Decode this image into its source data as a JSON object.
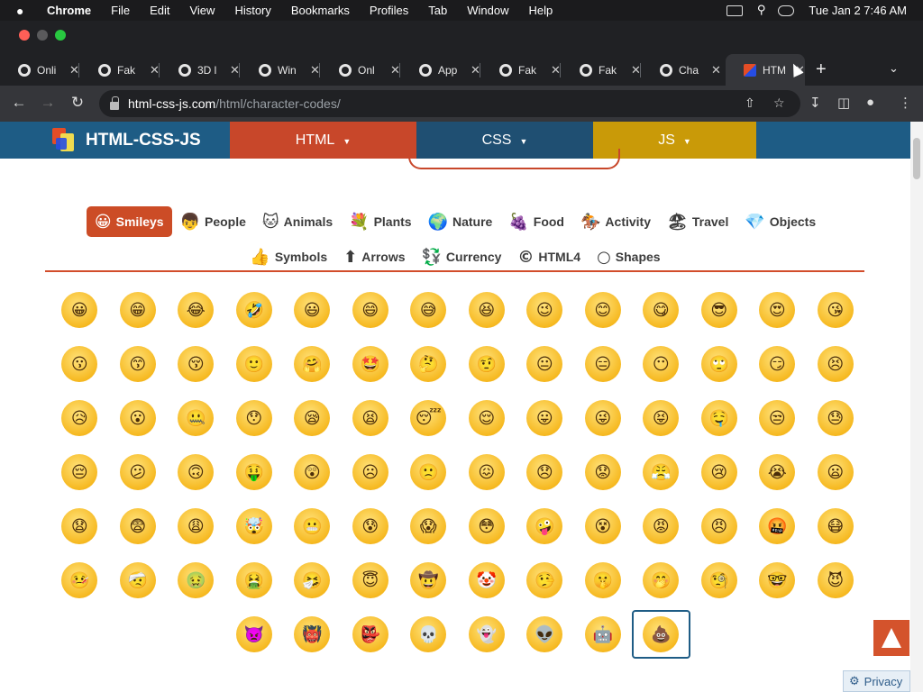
{
  "menubar": {
    "app": "Chrome",
    "items": [
      "File",
      "Edit",
      "View",
      "History",
      "Bookmarks",
      "Profiles",
      "Tab",
      "Window",
      "Help"
    ],
    "clock": "Tue Jan 2  7:46 AM"
  },
  "tabs": [
    {
      "title": "Onli"
    },
    {
      "title": "Fak"
    },
    {
      "title": "3D l"
    },
    {
      "title": "Win"
    },
    {
      "title": "Onl"
    },
    {
      "title": "App"
    },
    {
      "title": "Fak"
    },
    {
      "title": "Fak"
    },
    {
      "title": "Cha"
    },
    {
      "title": "HTM",
      "active": true
    }
  ],
  "url": {
    "host": "html-css-js.com",
    "path": "/html/character-codes/"
  },
  "site": {
    "brand": "HTML-CSS-JS",
    "nav": [
      {
        "label": "HTML",
        "color": "#c8472a"
      },
      {
        "label": "CSS",
        "color": "#1e5c85"
      },
      {
        "label": "JS",
        "color": "#c99a08"
      }
    ]
  },
  "categories_row1": [
    {
      "label": "Smileys",
      "icon": "😀",
      "active": true
    },
    {
      "label": "People",
      "icon": "👦"
    },
    {
      "label": "Animals",
      "icon": "🐱"
    },
    {
      "label": "Plants",
      "icon": "💐"
    },
    {
      "label": "Nature",
      "icon": "🌍"
    },
    {
      "label": "Food",
      "icon": "🍇"
    },
    {
      "label": "Activity",
      "icon": "🏇"
    },
    {
      "label": "Travel",
      "icon": "🏖"
    },
    {
      "label": "Objects",
      "icon": "💎"
    }
  ],
  "categories_row2": [
    {
      "label": "Symbols",
      "icon": "👍"
    },
    {
      "label": "Arrows",
      "icon": "⬆"
    },
    {
      "label": "Currency",
      "icon": "💱"
    },
    {
      "label": "HTML4",
      "icon": "©"
    },
    {
      "label": "Shapes",
      "icon": "○"
    }
  ],
  "emoji_rows": [
    [
      {
        "name": "grinning-face",
        "glyph": "😀"
      },
      {
        "name": "beaming-face",
        "glyph": "😁"
      },
      {
        "name": "face-with-tears-of-joy",
        "glyph": "😂"
      },
      {
        "name": "rolling-on-floor-laughing",
        "glyph": "🤣"
      },
      {
        "name": "grinning-big-eyes",
        "glyph": "😃"
      },
      {
        "name": "grinning-smiling-eyes",
        "glyph": "😄"
      },
      {
        "name": "grinning-sweat",
        "glyph": "😅"
      },
      {
        "name": "squinting-face",
        "glyph": "😆"
      },
      {
        "name": "winking-face",
        "glyph": "😉"
      },
      {
        "name": "smiling-eyes",
        "glyph": "😊"
      },
      {
        "name": "savoring-food",
        "glyph": "😋"
      },
      {
        "name": "sunglasses-face",
        "glyph": "😎"
      },
      {
        "name": "heart-eyes",
        "glyph": "😍"
      },
      {
        "name": "blowing-kiss",
        "glyph": "😘"
      }
    ],
    [
      {
        "name": "kissing-face",
        "glyph": "😗"
      },
      {
        "name": "kissing-smiling-eyes",
        "glyph": "😙"
      },
      {
        "name": "kissing-closed-eyes",
        "glyph": "😚"
      },
      {
        "name": "slightly-smiling",
        "glyph": "🙂"
      },
      {
        "name": "hugging-face",
        "glyph": "🤗"
      },
      {
        "name": "star-struck",
        "glyph": "🤩"
      },
      {
        "name": "thinking-face",
        "glyph": "🤔"
      },
      {
        "name": "raised-eyebrow",
        "glyph": "🤨"
      },
      {
        "name": "neutral-face",
        "glyph": "😐"
      },
      {
        "name": "expressionless",
        "glyph": "😑"
      },
      {
        "name": "no-mouth",
        "glyph": "😶"
      },
      {
        "name": "rolling-eyes",
        "glyph": "🙄"
      },
      {
        "name": "smirking-face",
        "glyph": "😏"
      },
      {
        "name": "persevering-face",
        "glyph": "😣"
      }
    ],
    [
      {
        "name": "sad-relieved",
        "glyph": "😥"
      },
      {
        "name": "open-mouth",
        "glyph": "😮"
      },
      {
        "name": "zipper-mouth",
        "glyph": "🤐"
      },
      {
        "name": "hushed-face",
        "glyph": "😯"
      },
      {
        "name": "sleepy-face",
        "glyph": "😪"
      },
      {
        "name": "tired-face",
        "glyph": "😫"
      },
      {
        "name": "sleeping-face",
        "glyph": "😴"
      },
      {
        "name": "relieved-face",
        "glyph": "😌"
      },
      {
        "name": "tongue-out",
        "glyph": "😛"
      },
      {
        "name": "winking-tongue",
        "glyph": "😜"
      },
      {
        "name": "squinting-tongue",
        "glyph": "😝"
      },
      {
        "name": "drooling-face",
        "glyph": "🤤"
      },
      {
        "name": "unamused-face",
        "glyph": "😒"
      },
      {
        "name": "downcast-sweat",
        "glyph": "😓"
      }
    ],
    [
      {
        "name": "pensive-face",
        "glyph": "😔"
      },
      {
        "name": "confused-face",
        "glyph": "😕"
      },
      {
        "name": "upside-down",
        "glyph": "🙃"
      },
      {
        "name": "money-mouth",
        "glyph": "🤑"
      },
      {
        "name": "astonished-face",
        "glyph": "😲"
      },
      {
        "name": "frowning-face",
        "glyph": "☹"
      },
      {
        "name": "slightly-frowning",
        "glyph": "🙁"
      },
      {
        "name": "confounded-face",
        "glyph": "😖"
      },
      {
        "name": "disappointed-face",
        "glyph": "😞"
      },
      {
        "name": "worried-face",
        "glyph": "😟"
      },
      {
        "name": "steam-from-nose",
        "glyph": "😤"
      },
      {
        "name": "crying-face",
        "glyph": "😢"
      },
      {
        "name": "loudly-crying",
        "glyph": "😭"
      },
      {
        "name": "frowning-open-mouth",
        "glyph": "😦"
      }
    ],
    [
      {
        "name": "anguished-face",
        "glyph": "😧"
      },
      {
        "name": "fearful-face",
        "glyph": "😨"
      },
      {
        "name": "weary-face",
        "glyph": "😩"
      },
      {
        "name": "exploding-head",
        "glyph": "🤯"
      },
      {
        "name": "grimacing-face",
        "glyph": "😬"
      },
      {
        "name": "anxious-sweat",
        "glyph": "😰"
      },
      {
        "name": "screaming-fear",
        "glyph": "😱"
      },
      {
        "name": "flushed-face",
        "glyph": "😳"
      },
      {
        "name": "zany-face",
        "glyph": "🤪"
      },
      {
        "name": "dizzy-face",
        "glyph": "😵"
      },
      {
        "name": "pouting-face",
        "glyph": "😡"
      },
      {
        "name": "angry-face",
        "glyph": "😠"
      },
      {
        "name": "cursing-face",
        "glyph": "🤬"
      },
      {
        "name": "medical-mask",
        "glyph": "😷"
      }
    ],
    [
      {
        "name": "thermometer-face",
        "glyph": "🤒"
      },
      {
        "name": "head-bandage",
        "glyph": "🤕"
      },
      {
        "name": "nauseated-face",
        "glyph": "🤢"
      },
      {
        "name": "vomiting-face",
        "glyph": "🤮"
      },
      {
        "name": "sneezing-face",
        "glyph": "🤧"
      },
      {
        "name": "halo-face",
        "glyph": "😇"
      },
      {
        "name": "cowboy-face",
        "glyph": "🤠"
      },
      {
        "name": "clown-face",
        "glyph": "🤡"
      },
      {
        "name": "lying-face",
        "glyph": "🤥"
      },
      {
        "name": "shushing-face",
        "glyph": "🤫"
      },
      {
        "name": "hand-over-mouth",
        "glyph": "🤭"
      },
      {
        "name": "monocle-face",
        "glyph": "🧐"
      },
      {
        "name": "nerd-face",
        "glyph": "🤓"
      },
      {
        "name": "smiling-horns",
        "glyph": "😈"
      }
    ],
    [
      {
        "name": "angry-horns",
        "glyph": "👿"
      },
      {
        "name": "ogre",
        "glyph": "👹"
      },
      {
        "name": "goblin",
        "glyph": "👺"
      },
      {
        "name": "skull",
        "glyph": "💀"
      },
      {
        "name": "ghost",
        "glyph": "👻"
      },
      {
        "name": "alien",
        "glyph": "👽"
      },
      {
        "name": "robot",
        "glyph": "🤖"
      },
      {
        "name": "pile-of-poo",
        "glyph": "💩",
        "selected": true
      }
    ]
  ],
  "privacy_label": "Privacy"
}
